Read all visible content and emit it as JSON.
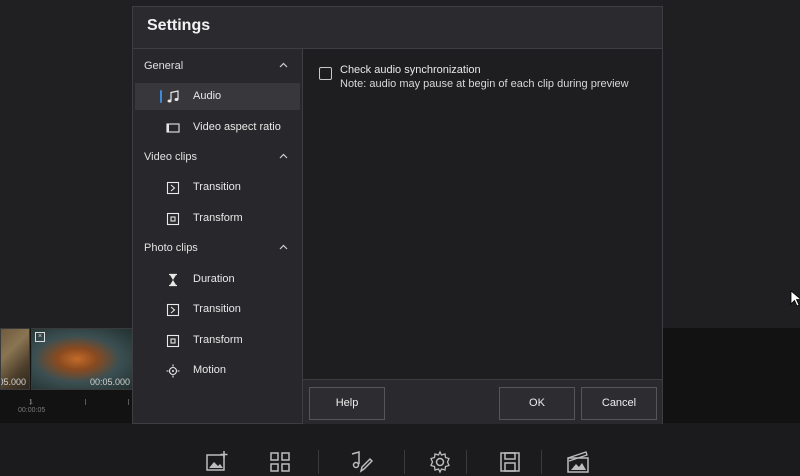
{
  "dialog": {
    "title": "Settings"
  },
  "sidebar": {
    "groups": [
      {
        "label": "General",
        "chevron": "chevron-up-icon"
      },
      {
        "label": "Video clips",
        "chevron": "chevron-up-icon"
      },
      {
        "label": "Photo clips",
        "chevron": "chevron-up-icon"
      }
    ],
    "items": [
      {
        "label": "Audio",
        "icon": "music-note-icon",
        "selected": true
      },
      {
        "label": "Video aspect ratio",
        "icon": "aspect-ratio-icon"
      },
      {
        "label": "Transition",
        "icon": "transition-icon"
      },
      {
        "label": "Transform",
        "icon": "transform-icon"
      },
      {
        "label": "Duration",
        "icon": "hourglass-icon"
      },
      {
        "label": "Transition",
        "icon": "transition-icon"
      },
      {
        "label": "Transform",
        "icon": "transform-icon"
      },
      {
        "label": "Motion",
        "icon": "motion-icon"
      }
    ]
  },
  "content": {
    "checkbox_label": "Check audio synchronization",
    "checkbox_checked": false,
    "note": "Note: audio may pause at begin of each clip during preview"
  },
  "footer": {
    "help_label": "Help",
    "ok_label": "OK",
    "cancel_label": "Cancel"
  },
  "timeline": {
    "clips": [
      {
        "time": "05.000"
      },
      {
        "time": "00:05.000"
      }
    ],
    "ruler_labels": [
      "00:00:05",
      "1"
    ]
  },
  "bottom_toolbar": {
    "icons": [
      "add-media-icon",
      "grid-icon",
      "edit-music-icon",
      "gear-icon",
      "save-icon",
      "export-icon"
    ]
  },
  "colors": {
    "accent": "#3d8bd9",
    "dialog_bg": "#2a2a2e",
    "content_bg": "#1e1e21"
  }
}
